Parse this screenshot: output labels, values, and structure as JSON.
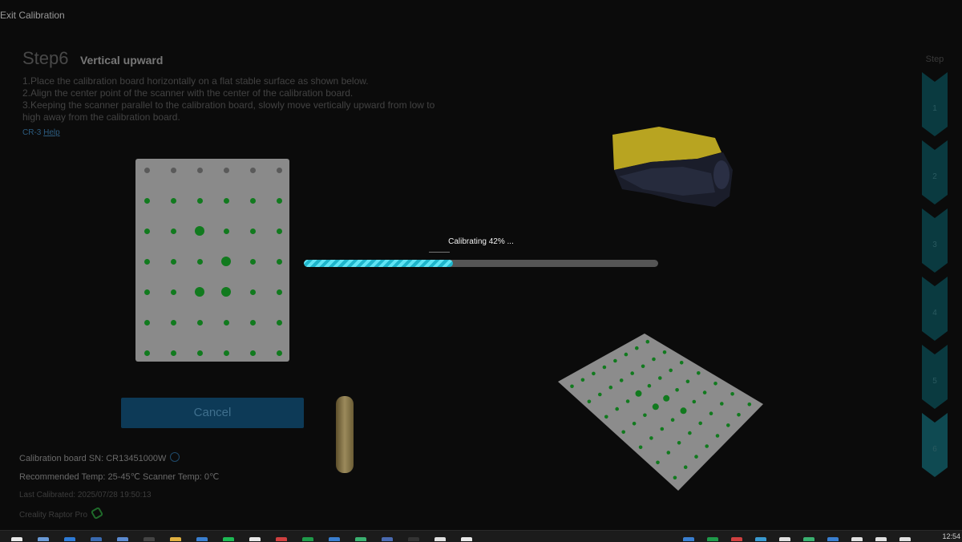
{
  "header": {
    "exit_label": "Exit Calibration"
  },
  "step": {
    "number_label": "Step6",
    "name": "Vertical upward",
    "instructions": [
      "1.Place the calibration board horizontally on a flat stable surface as shown below.",
      "2.Align the center point of the scanner with the center of the calibration board.",
      "3.Keeping the scanner parallel to the calibration board, slowly move vertically upward from low to high away from the calibration board."
    ],
    "help_prefix": "CR-3",
    "help_link": "Help"
  },
  "progress": {
    "label": "Calibrating 42% ...",
    "percent": 42
  },
  "actions": {
    "cancel_label": "Cancel"
  },
  "info": {
    "board_sn": "Calibration board SN: CR13451000W",
    "temps": "Recommended Temp: 25-45℃ Scanner Temp: 0℃",
    "last_calibrated": "Last Calibrated: 2025/07/28 19:50:13",
    "product": "Creality Raptor Pro"
  },
  "stepper": {
    "title": "Step",
    "steps": [
      "1",
      "2",
      "3",
      "4",
      "5",
      "6"
    ],
    "active": "6"
  },
  "colors": {
    "accent": "#1fb6cc",
    "dot_green": "#117a1e",
    "button": "#0d3a57"
  },
  "taskbar": {
    "icons": [
      "windows-icon",
      "explorer-icon",
      "edge-icon",
      "store-icon",
      "mail-icon",
      "obs-icon",
      "folder-icon",
      "calendar-icon",
      "spotify-icon",
      "chrome-icon",
      "app-icon",
      "excel-icon",
      "bluetooth-icon",
      "photos-icon",
      "app-icon",
      "terminal-icon",
      "calculator-icon",
      "notes-icon"
    ],
    "clock": "12:54"
  }
}
